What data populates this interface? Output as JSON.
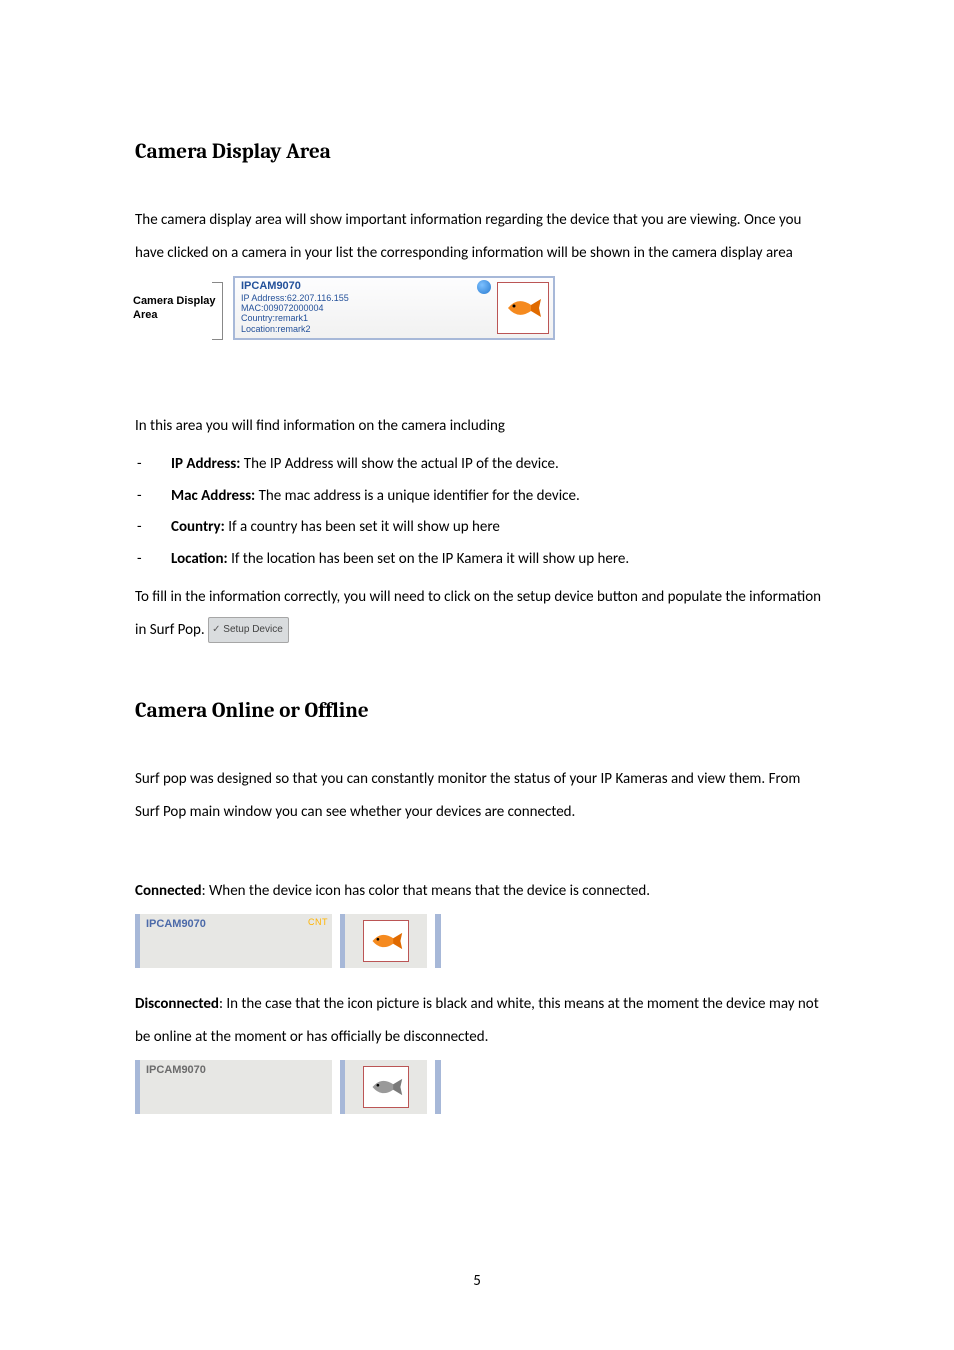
{
  "headings": {
    "h1": "Camera Display Area",
    "h2": "Camera Online or Offline"
  },
  "paras": {
    "p1": "The camera display area will show important information regarding the device that you are viewing. Once you have clicked on a camera in your list the corresponding information will be shown in the camera display area",
    "p2": "In this area you will find information on the camera including",
    "p3a": "To fill in the information correctly, you will need to click on the setup device button and populate the information in Surf Pop. ",
    "p4": "Surf pop was designed so that you can constantly monitor the status of your IP Kameras and view them. From Surf Pop main window you can see whether your devices are connected.",
    "p5a": "Connected",
    "p5b": ": When the device icon has color that means that the device is connected.",
    "p6a": "Disconnected",
    "p6b": ": In the case that the icon picture is black and white, this means at the moment the device may not be online at the moment or has officially be disconnected."
  },
  "info_list": [
    {
      "label": "IP Address:",
      "text": " The IP Address will show the actual IP of the device."
    },
    {
      "label": "Mac Address:",
      "text": " The mac address is a unique identifier for the device."
    },
    {
      "label": "Country:",
      "text": " If a country has been set it will show up here"
    },
    {
      "label": "Location:",
      "text": " If the location has been set on the IP Kamera it will show up here."
    }
  ],
  "panel": {
    "left_label_l1": "Camera Display",
    "left_label_l2": "Area",
    "title": "IPCAM9070",
    "ip": "IP Address:62.207.116.155",
    "mac": "MAC:009072000004",
    "country": "Country:remark1",
    "location": "Location:remark2"
  },
  "setup_btn": "Setup Device",
  "status": {
    "connected_label": "IPCAM9070",
    "cnt_badge": "CNT",
    "disconnected_label": "IPCAM9070"
  },
  "page_number": "5"
}
